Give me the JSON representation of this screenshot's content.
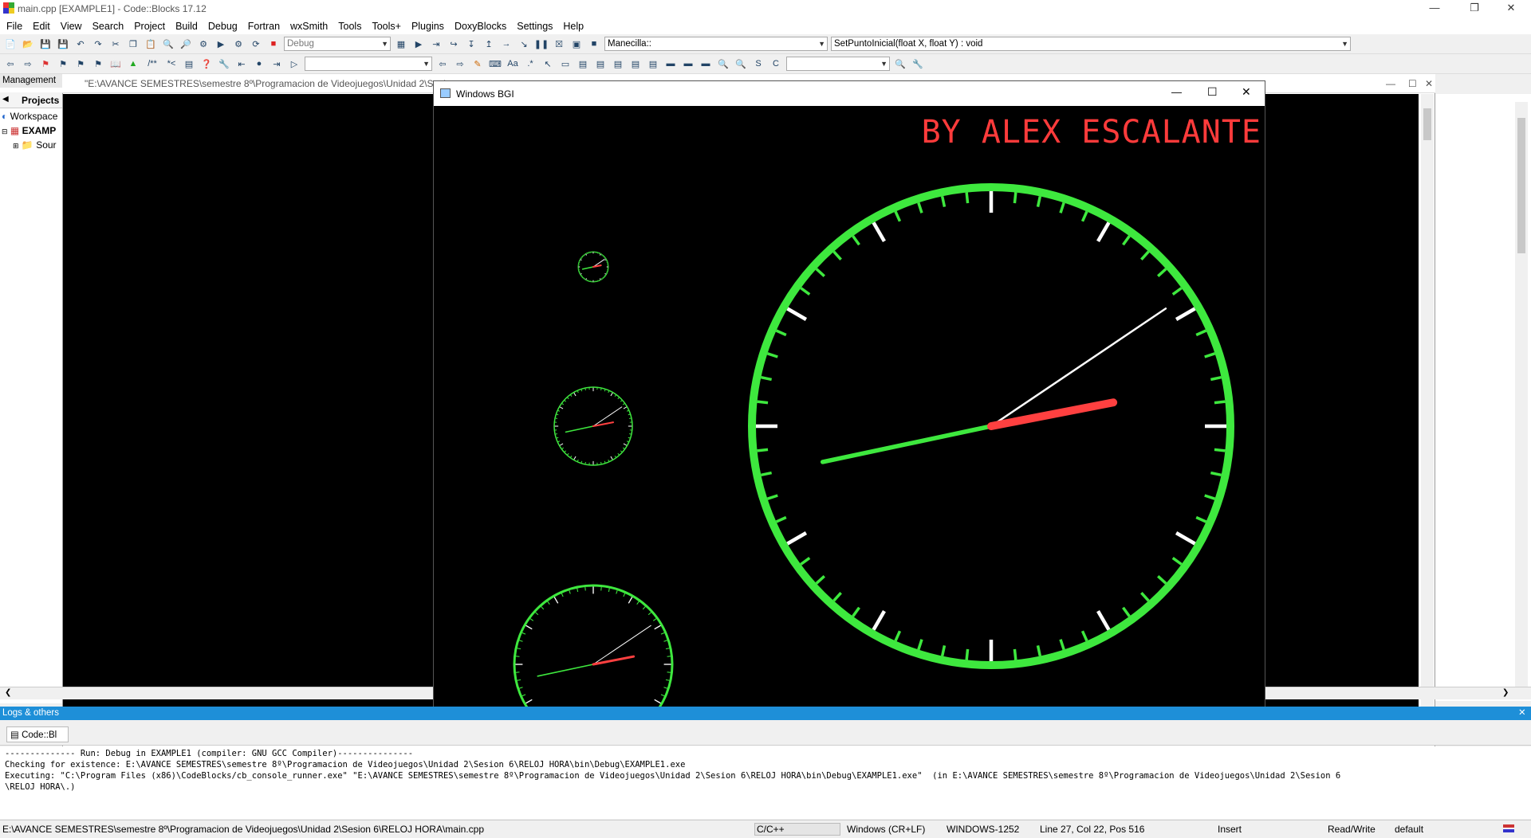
{
  "window": {
    "title": "main.cpp [EXAMPLE1] - Code::Blocks 17.12"
  },
  "menu": [
    "File",
    "Edit",
    "View",
    "Search",
    "Project",
    "Build",
    "Debug",
    "Fortran",
    "wxSmith",
    "Tools",
    "Tools+",
    "Plugins",
    "DoxyBlocks",
    "Settings",
    "Help"
  ],
  "toolbar": {
    "build_target": "Debug",
    "scope_combo": "Manecilla::",
    "function_combo": "SetPuntoInicial(float X, float Y) : void",
    "search_combo": "",
    "comment_btn": "/**",
    "uncomment_btn": "*<"
  },
  "management": {
    "title": "Management",
    "tab": "Projects",
    "workspace": "Workspace",
    "project": "EXAMP",
    "sources": "Sour"
  },
  "editor": {
    "path": "\"E:\\AVANCE SEMESTRES\\semestre 8º\\Programacion de Videojuegos\\Unidad 2\\Sesi"
  },
  "bgi": {
    "title": "Windows BGI",
    "banner": "BY ALEX ESCALANTE",
    "colors": {
      "face": "#3ee83e",
      "hour_hand": "#ff4040",
      "minute_hand": "#3ee83e",
      "second_hand": "#ffffff",
      "banner": "#ff3b3b"
    }
  },
  "logs": {
    "header": "Logs & others",
    "tab": "Code::Bl",
    "lines": [
      "-------------- Run: Debug in EXAMPLE1 (compiler: GNU GCC Compiler)---------------",
      "Checking for existence: E:\\AVANCE SEMESTRES\\semestre 8º\\Programacion de Videojuegos\\Unidad 2\\Sesion 6\\RELOJ HORA\\bin\\Debug\\EXAMPLE1.exe",
      "Executing: \"C:\\Program Files (x86)\\CodeBlocks/cb_console_runner.exe\" \"E:\\AVANCE SEMESTRES\\semestre 8º\\Programacion de Videojuegos\\Unidad 2\\Sesion 6\\RELOJ HORA\\bin\\Debug\\EXAMPLE1.exe\"  (in E:\\AVANCE SEMESTRES\\semestre 8º\\Programacion de Videojuegos\\Unidad 2\\Sesion 6",
      "\\RELOJ HORA\\.)"
    ]
  },
  "status": {
    "file_path": "E:\\AVANCE SEMESTRES\\semestre 8º\\Programacion de Videojuegos\\Unidad 2\\Sesion 6\\RELOJ HORA\\main.cpp",
    "language": "C/C++",
    "line_endings": "Windows (CR+LF)",
    "encoding": "WINDOWS-1252",
    "position": "Line 27, Col 22, Pos 516",
    "mode": "Insert",
    "access": "Read/Write",
    "profile": "default"
  }
}
